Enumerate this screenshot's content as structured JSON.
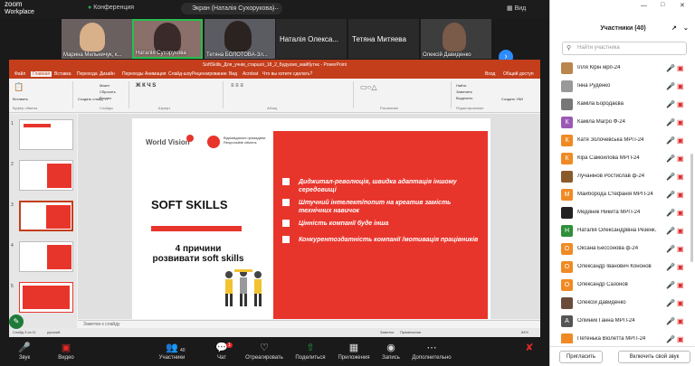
{
  "zoom": {
    "logo_top": "zoom",
    "logo_bottom": "Workplace",
    "conference": "Конференция",
    "screen_label": "Экран (Наталія Сухорукова)",
    "view": "Вид"
  },
  "thumbs": [
    "Марина Мельничук, к...",
    "Наталія Сухорукова",
    "Тетяна БОЛОТОВА-Зл...",
    "Наталія Олекса...",
    "Тетяна Митяева",
    "Олексій Давиденко"
  ],
  "thumbs_big": [
    "Наталія Олекса...",
    "Тетяна Митяева"
  ],
  "ppt": {
    "title": "SoftSkills_Для_учнів_старшої_18_2_Будуємо_майбутнє - PowerPoint",
    "tabs": [
      "Файл",
      "Главная",
      "Вставка",
      "Перехода",
      "Дизайн",
      "Переходы",
      "Анимация",
      "Слайд-шоу",
      "Рецензирование",
      "Вид",
      "Acrobat",
      "Что вы хотите сделать?",
      "Вход",
      "Общий доступ"
    ],
    "ribbon": {
      "paste": "Вставить",
      "create": "Создать слайд",
      "layout": "Макет",
      "reset": "Сбросить",
      "section": "Раздел",
      "replace": "Заменить",
      "find": "Найти",
      "select": "Выделить",
      "dictate": "Создать УКИ"
    },
    "groups": [
      "Буфер обмена",
      "Слайды",
      "Шрифт",
      "Абзац",
      "Рисование",
      "Редактирование"
    ],
    "slide_nums": [
      "1",
      "2",
      "3",
      "4",
      "5"
    ],
    "slide": {
      "wv": "World Vision",
      "org": "Відповідальні громадяни",
      "org2": "Responsible citizens",
      "soft": "SOFT SKILLS",
      "reasons_line1": "4 причини",
      "reasons_line2": "розвивати soft skills",
      "items": [
        "Диджитал-революція, швидка адаптація іншому середовищі",
        "Штучний інтелект/попит на креатив замість технічних навичок",
        "Цінність компанії буде інша",
        "Конкурентоздатність компанії /мотивація працівників"
      ]
    },
    "notes": "Заметки к слайду",
    "status_left": "Слайд 3 из 11",
    "status_lang": "русский",
    "status_notes": "Заметки",
    "status_comments": "Примечания",
    "zoom": "84%"
  },
  "bottom": {
    "buttons": [
      "Звук",
      "Видео",
      "Участники",
      "Чат",
      "Отреагировать",
      "Поделиться",
      "Приложения",
      "Запись",
      "Дополнительно"
    ],
    "participants_count": "40",
    "chat_badge": "1"
  },
  "side": {
    "header": "Участники (40)",
    "search_placeholder": "Найти участника",
    "participants": [
      {
        "name": "Ілля Кірін мрп-24",
        "initial": "",
        "color": "#b9864d"
      },
      {
        "name": "Інна Руденко",
        "initial": "",
        "color": "#999999"
      },
      {
        "name": "Каміла Бородаєва",
        "initial": "",
        "color": "#777777"
      },
      {
        "name": "Каміла Магро Ф-24",
        "initial": "К",
        "color": "#9b59b6"
      },
      {
        "name": "Катя Золочевська МРП-24",
        "initial": "К",
        "color": "#f08a24"
      },
      {
        "name": "Кіра Самойлова МРП-24",
        "initial": "К",
        "color": "#f08a24"
      },
      {
        "name": "Лучанінов Ростислав ф-24",
        "initial": "",
        "color": "#8b5a2b"
      },
      {
        "name": "Майборода Стефанія МРП-24",
        "initial": "М",
        "color": "#f08a24"
      },
      {
        "name": "Медяник Никита МРП-24",
        "initial": "",
        "color": "#222222"
      },
      {
        "name": "Наталія Олександрівна Резенк...",
        "initial": "Н",
        "color": "#2f8f3a"
      },
      {
        "name": "Оксана Бессонова ф-24",
        "initial": "О",
        "color": "#f08a24"
      },
      {
        "name": "Олександр Іванович Кононов",
        "initial": "О",
        "color": "#f08a24"
      },
      {
        "name": "Олександр Сазонов",
        "initial": "О",
        "color": "#f08a24"
      },
      {
        "name": "Олексій Давиденко",
        "initial": "",
        "color": "#6b4b3a"
      },
      {
        "name": "Олійник Ганна МРП-24",
        "initial": "А",
        "color": "#555555"
      },
      {
        "name": "Петенька Віолетта МРП-24",
        "initial": "",
        "color": "#f08a24"
      }
    ],
    "invite": "Пригласить",
    "unmute": "Включить свой звук"
  }
}
